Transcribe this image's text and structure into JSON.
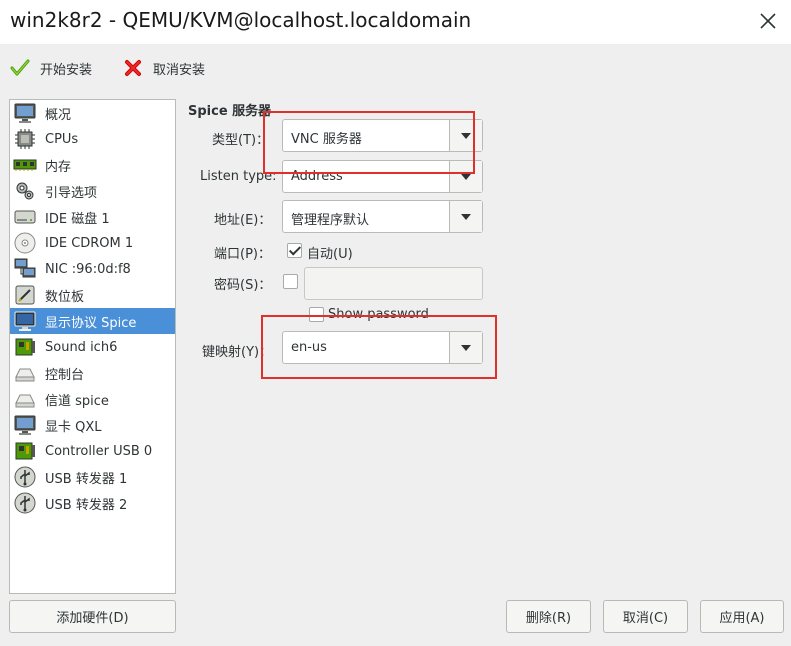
{
  "window": {
    "title": "win2k8r2 - QEMU/KVM@localhost.localdomain"
  },
  "toolbar": {
    "begin_install": "开始安装",
    "cancel_install": "取消安装"
  },
  "sidebar": {
    "items": [
      {
        "label": "概况",
        "icon": "monitor-icon"
      },
      {
        "label": "CPUs",
        "icon": "cpu-icon"
      },
      {
        "label": "内存",
        "icon": "memory-icon"
      },
      {
        "label": "引导选项",
        "icon": "boot-options-icon"
      },
      {
        "label": "IDE 磁盘 1",
        "icon": "disk-icon"
      },
      {
        "label": "IDE CDROM 1",
        "icon": "cdrom-icon"
      },
      {
        "label": "NIC :96:0d:f8",
        "icon": "network-icon"
      },
      {
        "label": "数位板",
        "icon": "tablet-icon"
      },
      {
        "label": "显示协议 Spice",
        "icon": "display-icon",
        "selected": true
      },
      {
        "label": "Sound ich6",
        "icon": "sound-card-icon"
      },
      {
        "label": "控制台",
        "icon": "console-icon"
      },
      {
        "label": "信道 spice",
        "icon": "channel-icon"
      },
      {
        "label": "显卡 QXL",
        "icon": "video-card-icon"
      },
      {
        "label": "Controller USB 0",
        "icon": "usb-controller-icon"
      },
      {
        "label": "USB 转发器 1",
        "icon": "usb-redirector-icon"
      },
      {
        "label": "USB 转发器 2",
        "icon": "usb-redirector-icon"
      }
    ]
  },
  "buttons": {
    "add_hardware": "添加硬件(D)",
    "remove": "删除(R)",
    "cancel": "取消(C)",
    "apply": "应用(A)"
  },
  "form": {
    "section_title": "Spice 服务器",
    "type_label": "类型(T)：",
    "type_value": "VNC 服务器",
    "listen_label": "Listen type:",
    "listen_value": "Address",
    "address_label": "地址(E)：",
    "address_value": "管理程序默认",
    "port_label": "端口(P)：",
    "port_auto_label": "自动(U)",
    "port_auto_checked": true,
    "password_label": "密码(S)：",
    "password_checked": false,
    "password_value": "",
    "show_password_label": "Show password",
    "show_password_checked": false,
    "keymap_label": "键映射(Y)：",
    "keymap_value": "en-us"
  },
  "colors": {
    "accent": "#4a90d9",
    "highlight_box": "#e0302c"
  }
}
